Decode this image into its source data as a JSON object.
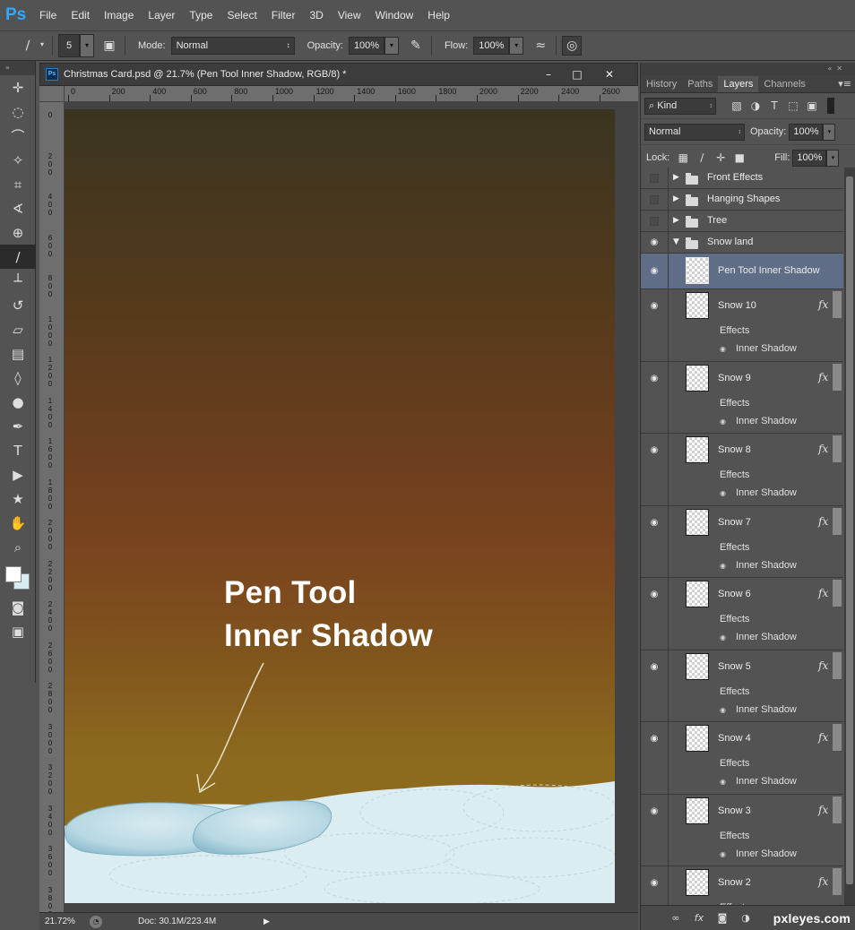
{
  "app": {
    "logo": "Ps"
  },
  "menu": [
    "File",
    "Edit",
    "Image",
    "Layer",
    "Type",
    "Select",
    "Filter",
    "3D",
    "View",
    "Window",
    "Help"
  ],
  "options_bar": {
    "brush_size": "5",
    "mode_label": "Mode:",
    "mode_value": "Normal",
    "opacity_label": "Opacity:",
    "opacity_value": "100%",
    "flow_label": "Flow:",
    "flow_value": "100%"
  },
  "document": {
    "title": "Christmas Card.psd @ 21.7% (Pen Tool Inner Shadow, RGB/8) *",
    "ps_icon": "Ps",
    "ruler_top": [
      "0",
      "200",
      "400",
      "600",
      "800",
      "1000",
      "1200",
      "1400",
      "1600",
      "1800",
      "2000",
      "2200",
      "2400",
      "2600"
    ],
    "ruler_left": [
      [
        "0"
      ],
      [
        "2",
        "0",
        "0"
      ],
      [
        "4",
        "0",
        "0"
      ],
      [
        "6",
        "0",
        "0"
      ],
      [
        "8",
        "0",
        "0"
      ],
      [
        "1",
        "0",
        "0",
        "0"
      ],
      [
        "1",
        "2",
        "0",
        "0"
      ],
      [
        "1",
        "4",
        "0",
        "0"
      ],
      [
        "1",
        "6",
        "0",
        "0"
      ],
      [
        "1",
        "8",
        "0",
        "0"
      ],
      [
        "2",
        "0",
        "0",
        "0"
      ],
      [
        "2",
        "2",
        "0",
        "0"
      ],
      [
        "2",
        "4",
        "0",
        "0"
      ],
      [
        "2",
        "6",
        "0",
        "0"
      ],
      [
        "2",
        "8",
        "0",
        "0"
      ],
      [
        "3",
        "0",
        "0",
        "0"
      ],
      [
        "3",
        "2",
        "0",
        "0"
      ],
      [
        "3",
        "4",
        "0",
        "0"
      ],
      [
        "3",
        "6",
        "0",
        "0"
      ],
      [
        "3",
        "8",
        "0",
        "0"
      ]
    ],
    "annotation_line1": "Pen Tool",
    "annotation_line2": "Inner Shadow",
    "zoom": "21.72%",
    "doc_size": "Doc: 30.1M/223.4M"
  },
  "colors": {
    "foreground": "#ffffff",
    "background": "#d7ecf3",
    "snow": "#dcedf2",
    "snow_shadow": "#9fc7d6",
    "selection": "#5f6e86"
  },
  "panel": {
    "tabs": [
      "History",
      "Paths",
      "Layers",
      "Channels"
    ],
    "active_tab": "Layers",
    "filter_kind": "Kind",
    "blend_mode": "Normal",
    "opacity_label": "Opacity:",
    "opacity_value": "100%",
    "lock_label": "Lock:",
    "fill_label": "Fill:",
    "fill_value": "100%",
    "groups": [
      {
        "name": "Front Effects"
      },
      {
        "name": "Hanging Shapes"
      },
      {
        "name": "Tree"
      },
      {
        "name": "Snow land"
      }
    ],
    "selected_layer": "Pen Tool Inner Shadow",
    "effects_label": "Effects",
    "effect_name": "Inner Shadow",
    "snow_layers": [
      "Snow 10",
      "Snow 9",
      "Snow 8",
      "Snow 7",
      "Snow 6",
      "Snow 5",
      "Snow 4",
      "Snow 3",
      "Snow 2"
    ],
    "fx_symbol": "fx",
    "watermark": "pxleyes.com"
  }
}
